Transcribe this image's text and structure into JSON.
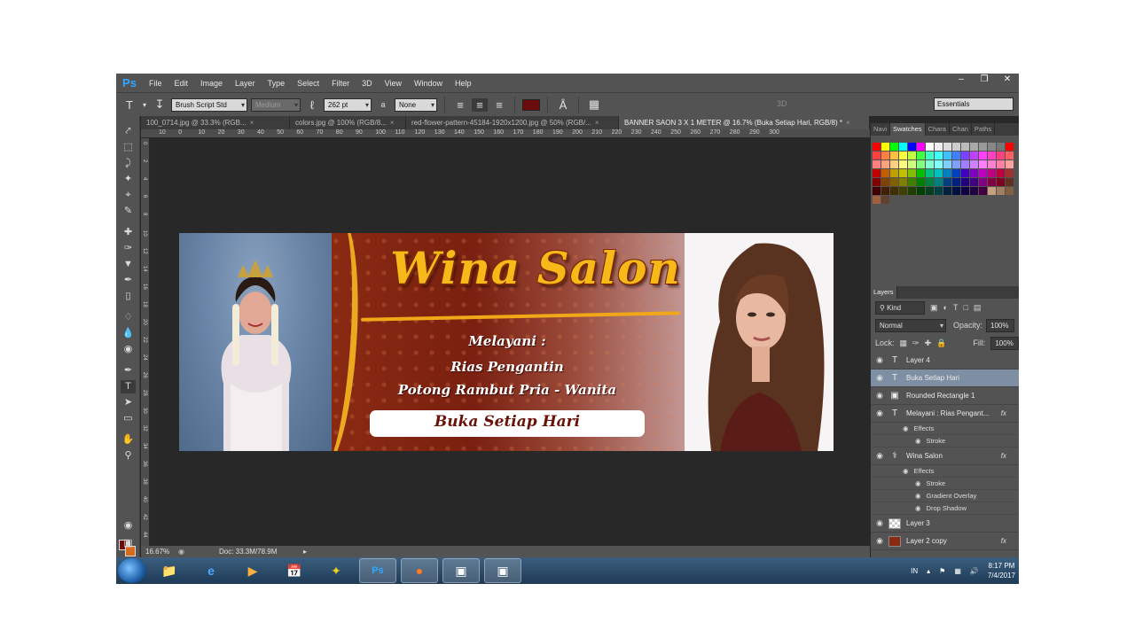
{
  "menubar": {
    "logo": "Ps",
    "items": [
      "File",
      "Edit",
      "Image",
      "Layer",
      "Type",
      "Select",
      "Filter",
      "3D",
      "View",
      "Window",
      "Help"
    ]
  },
  "options": {
    "font_family": "Brush Script Std",
    "font_style": "Medium",
    "font_size": "262 pt",
    "aa_label": "a",
    "antialias": "None",
    "threed_label": "3D",
    "workspace": "Essentials",
    "text_color": "#6a0c0c"
  },
  "tabs": [
    {
      "label": "100_0714.jpg @ 33.3% (RGB...",
      "active": false
    },
    {
      "label": "colors.jpg @ 100% (RGB/8...",
      "active": false
    },
    {
      "label": "red-flower-pattern-45184-1920x1200.jpg @ 50% (RGB/...",
      "active": false
    },
    {
      "label": "BANNER SAON 3 X 1 METER @ 16.7% (Buka Setiap Hari, RGB/8) *",
      "active": true
    }
  ],
  "ruler_top": [
    "10",
    "0",
    "10",
    "20",
    "30",
    "40",
    "50",
    "60",
    "70",
    "80",
    "90",
    "100",
    "110",
    "120",
    "130",
    "140",
    "150",
    "160",
    "170",
    "180",
    "190",
    "200",
    "210",
    "220",
    "230",
    "240",
    "250",
    "260",
    "270",
    "280",
    "290",
    "300"
  ],
  "ruler_left": [
    "0",
    "2",
    "4",
    "6",
    "8",
    "10",
    "12",
    "14",
    "16",
    "18",
    "20",
    "22",
    "24",
    "26",
    "28",
    "30",
    "32",
    "34",
    "36",
    "38",
    "40",
    "42",
    "44"
  ],
  "banner": {
    "title": "Wina Salon",
    "line1": "Melayani :",
    "line2": "Rias Pengantin",
    "line3": "Potong Rambut Pria - Wanita",
    "pill": "Buka Setiap Hari"
  },
  "status": {
    "zoom": "16.67%",
    "doc": "Doc: 33.3M/78.9M"
  },
  "swatches_panel": {
    "tabs": [
      "Navi",
      "Swatches",
      "Chara",
      "Chan",
      "Paths"
    ],
    "colors": [
      "#ff0000",
      "#ffff00",
      "#00ff00",
      "#00ffff",
      "#0000ff",
      "#ff00ff",
      "#ffffff",
      "#eeeeee",
      "#dddddd",
      "#cccccc",
      "#bbbbbb",
      "#aaaaaa",
      "#999999",
      "#888888",
      "#777777",
      "#ff0000",
      "#ff4040",
      "#ff8040",
      "#ffc040",
      "#ffff40",
      "#c0ff40",
      "#40ff40",
      "#40ffc0",
      "#40ffff",
      "#40c0ff",
      "#4080ff",
      "#8040ff",
      "#c040ff",
      "#ff40ff",
      "#ff40c0",
      "#ff4080",
      "#ff6060",
      "#ff8080",
      "#ffa080",
      "#ffd080",
      "#ffff80",
      "#d0ff80",
      "#80ff80",
      "#80ffd0",
      "#80ffff",
      "#80d0ff",
      "#80a0ff",
      "#a080ff",
      "#d080ff",
      "#ff80ff",
      "#ff80d0",
      "#ff80a0",
      "#ffa0a0",
      "#c00000",
      "#c06000",
      "#c0a000",
      "#c0c000",
      "#80c000",
      "#00c000",
      "#00c080",
      "#00c0c0",
      "#0080c0",
      "#0040c0",
      "#4000c0",
      "#8000c0",
      "#c000c0",
      "#c00080",
      "#c00040",
      "#a03030",
      "#800000",
      "#804000",
      "#806000",
      "#808000",
      "#408000",
      "#008000",
      "#008040",
      "#008080",
      "#004080",
      "#002080",
      "#200080",
      "#400080",
      "#800080",
      "#800040",
      "#800020",
      "#603020",
      "#400000",
      "#402000",
      "#403000",
      "#404000",
      "#204000",
      "#004000",
      "#004020",
      "#004040",
      "#002040",
      "#001040",
      "#100040",
      "#200040",
      "#400040",
      "#c8a080",
      "#a08060",
      "#806040",
      "#a06040",
      "#604030"
    ]
  },
  "layers_panel": {
    "title": "Layers",
    "filter": "Kind",
    "blend_mode": "Normal",
    "opacity_label": "Opacity:",
    "opacity": "100%",
    "lock_label": "Lock:",
    "fill_label": "Fill:",
    "fill": "100%",
    "fx_label": "fx",
    "effects_label": "Effects",
    "layers": [
      {
        "name": "Layer 4",
        "kind": "text",
        "selected": false
      },
      {
        "name": "Buka Setiap Hari",
        "kind": "text",
        "selected": true
      },
      {
        "name": "Rounded Rectangle 1",
        "kind": "shape",
        "selected": false
      },
      {
        "name": "Melayani : Rias Pengant...",
        "kind": "text",
        "selected": false,
        "fx": true,
        "effects": [
          "Stroke"
        ]
      },
      {
        "name": "Wina Salon",
        "kind": "warp",
        "selected": false,
        "fx": true,
        "effects": [
          "Stroke",
          "Gradient Overlay",
          "Drop Shadow"
        ]
      },
      {
        "name": "Layer 3",
        "kind": "image",
        "selected": false
      },
      {
        "name": "Layer 2 copy",
        "kind": "image",
        "selected": false,
        "fx": true
      }
    ]
  },
  "taskbar": {
    "apps": [
      "explorer",
      "internet-explorer",
      "media-player",
      "calendar",
      "tool",
      "photoshop",
      "firefox",
      "app1",
      "app2"
    ],
    "lang": "IN",
    "time": "8:17 PM",
    "date": "7/4/2017"
  }
}
